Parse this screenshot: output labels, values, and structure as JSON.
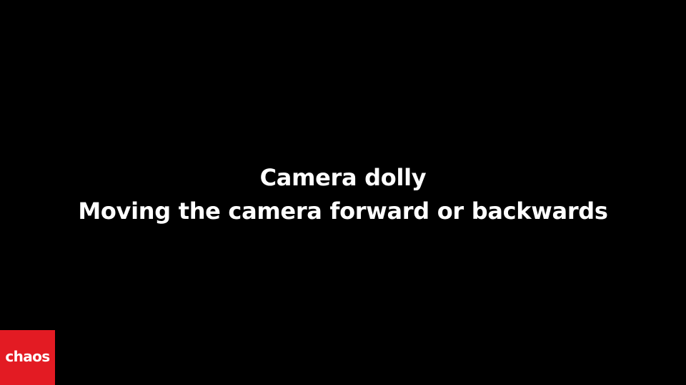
{
  "slide": {
    "title_line1": "Camera dolly",
    "title_line2": "Moving the camera forward or backwards",
    "background_color": "#000000",
    "text_color": "#ffffff"
  },
  "logo": {
    "text": "chaos",
    "background_color": "#e31b23"
  }
}
